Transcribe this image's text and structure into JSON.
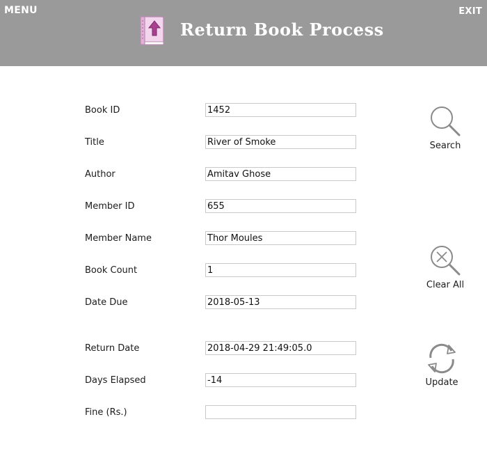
{
  "header": {
    "menu_label": "MENU",
    "exit_label": "EXIT",
    "title": "Return Book Process",
    "logo_icon": "return-book-icon"
  },
  "form": {
    "fields": [
      {
        "label": "Book ID",
        "value": "1452"
      },
      {
        "label": "Title",
        "value": "River of Smoke"
      },
      {
        "label": "Author",
        "value": "Amitav Ghose"
      },
      {
        "label": "Member ID",
        "value": "655"
      },
      {
        "label": "Member Name",
        "value": "Thor Moules"
      },
      {
        "label": "Book Count",
        "value": "1"
      },
      {
        "label": "Date Due",
        "value": "2018-05-13"
      },
      {
        "label": "Return Date",
        "value": "2018-04-29 21:49:05.0"
      },
      {
        "label": "Days Elapsed",
        "value": "-14"
      },
      {
        "label": "Fine (Rs.)",
        "value": ""
      }
    ]
  },
  "actions": {
    "search": {
      "label": "Search",
      "icon": "search-icon"
    },
    "clear": {
      "label": "Clear All",
      "icon": "clear-search-icon"
    },
    "update": {
      "label": "Update",
      "icon": "refresh-icon"
    }
  },
  "colors": {
    "header_bg": "#9b9a9a",
    "icon_gray": "#8a8a8a",
    "logo_pink": "#e7b3dc"
  }
}
